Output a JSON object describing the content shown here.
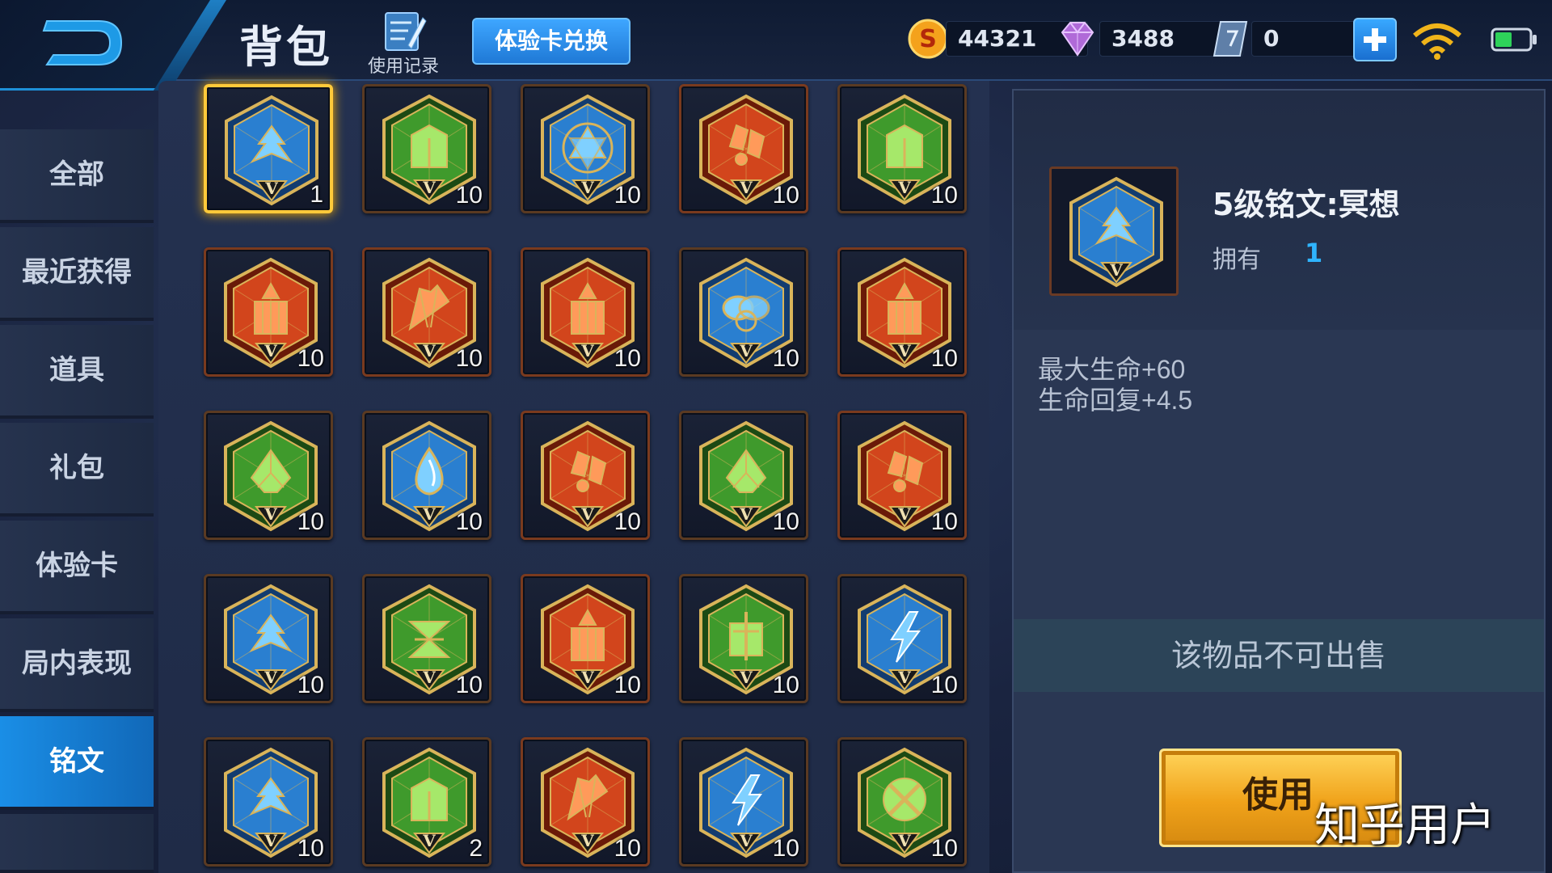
{
  "header": {
    "title": "背包",
    "history_label": "使用记录",
    "exchange_label": "体验卡兑换"
  },
  "currency": {
    "gold": "44321",
    "diamond": "3488",
    "voucher": "0"
  },
  "sidebar": {
    "items": [
      {
        "label": "全部"
      },
      {
        "label": "最近获得"
      },
      {
        "label": "道具"
      },
      {
        "label": "礼包"
      },
      {
        "label": "体验卡"
      },
      {
        "label": "局内表现"
      },
      {
        "label": "铭文"
      }
    ],
    "active_index": 6
  },
  "inscriptions": [
    {
      "color": "blue",
      "glyph": "wing",
      "count": "1",
      "selected": true
    },
    {
      "color": "green",
      "glyph": "gate",
      "count": "10"
    },
    {
      "color": "blue",
      "glyph": "star",
      "count": "10"
    },
    {
      "color": "red",
      "glyph": "crystal",
      "count": "10"
    },
    {
      "color": "green",
      "glyph": "gate",
      "count": "10"
    },
    {
      "color": "red",
      "glyph": "pillar",
      "count": "10"
    },
    {
      "color": "red",
      "glyph": "fan",
      "count": "10"
    },
    {
      "color": "red",
      "glyph": "pillar",
      "count": "10"
    },
    {
      "color": "blue",
      "glyph": "knot",
      "count": "10"
    },
    {
      "color": "red",
      "glyph": "pillar",
      "count": "10"
    },
    {
      "color": "green",
      "glyph": "leaf",
      "count": "10"
    },
    {
      "color": "blue",
      "glyph": "drop",
      "count": "10"
    },
    {
      "color": "red",
      "glyph": "crystal",
      "count": "10"
    },
    {
      "color": "green",
      "glyph": "leaf",
      "count": "10"
    },
    {
      "color": "red",
      "glyph": "crystal",
      "count": "10"
    },
    {
      "color": "blue",
      "glyph": "wing",
      "count": "10"
    },
    {
      "color": "green",
      "glyph": "hourglass",
      "count": "10"
    },
    {
      "color": "red",
      "glyph": "pillar",
      "count": "10"
    },
    {
      "color": "green",
      "glyph": "sword",
      "count": "10"
    },
    {
      "color": "blue",
      "glyph": "bolt",
      "count": "10"
    },
    {
      "color": "blue",
      "glyph": "wing",
      "count": "10"
    },
    {
      "color": "green",
      "glyph": "gate",
      "count": "2"
    },
    {
      "color": "red",
      "glyph": "fan",
      "count": "10"
    },
    {
      "color": "blue",
      "glyph": "bolt",
      "count": "10"
    },
    {
      "color": "green",
      "glyph": "cross",
      "count": "10"
    }
  ],
  "detail": {
    "name": "5级铭文:冥想",
    "owned_label": "拥有",
    "owned_count": "1",
    "stats": [
      "最大生命+60",
      "生命回复+4.5"
    ],
    "not_sellable": "该物品不可出售",
    "use_label": "使用"
  },
  "colors": {
    "blue": "#2a7fd0",
    "green": "#3f9a2c",
    "red": "#d2451c",
    "gold_trim": "#d9b45a",
    "accent": "#1a8ee6"
  },
  "watermark": "知乎用户"
}
